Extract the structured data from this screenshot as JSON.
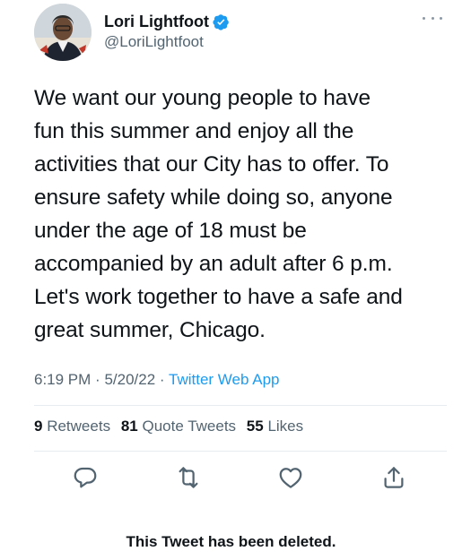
{
  "author": {
    "display_name": "Lori Lightfoot",
    "handle": "@LoriLightfoot",
    "avatar_icon": "profile-photo",
    "verified_icon": "verified-badge-icon",
    "verified_color": "#1d9bf0"
  },
  "tweet": {
    "text": "We want our young people to have\nfun this summer and enjoy all the\nactivities that our City has to offer. To\nensure safety while doing so, anyone\nunder the age of 18 must be\naccompanied by an adult after 6 p.m.\nLet's work together to have a safe and\ngreat summer, Chicago.",
    "time": "6:19 PM",
    "separator": "·",
    "date": "5/20/22",
    "source": "Twitter Web App"
  },
  "stats": {
    "retweets_count": "9",
    "retweets_label": "Retweets",
    "quotes_count": "81",
    "quotes_label": "Quote Tweets",
    "likes_count": "55",
    "likes_label": "Likes"
  },
  "actions": {
    "reply_icon": "reply-icon",
    "retweet_icon": "retweet-icon",
    "like_icon": "heart-icon",
    "share_icon": "share-icon"
  },
  "footer": {
    "deleted_notice": "This Tweet has been deleted."
  },
  "colors": {
    "text": "#0f1419",
    "secondary": "#536471",
    "link": "#1d9bf0",
    "divider": "#e6ecf0"
  }
}
